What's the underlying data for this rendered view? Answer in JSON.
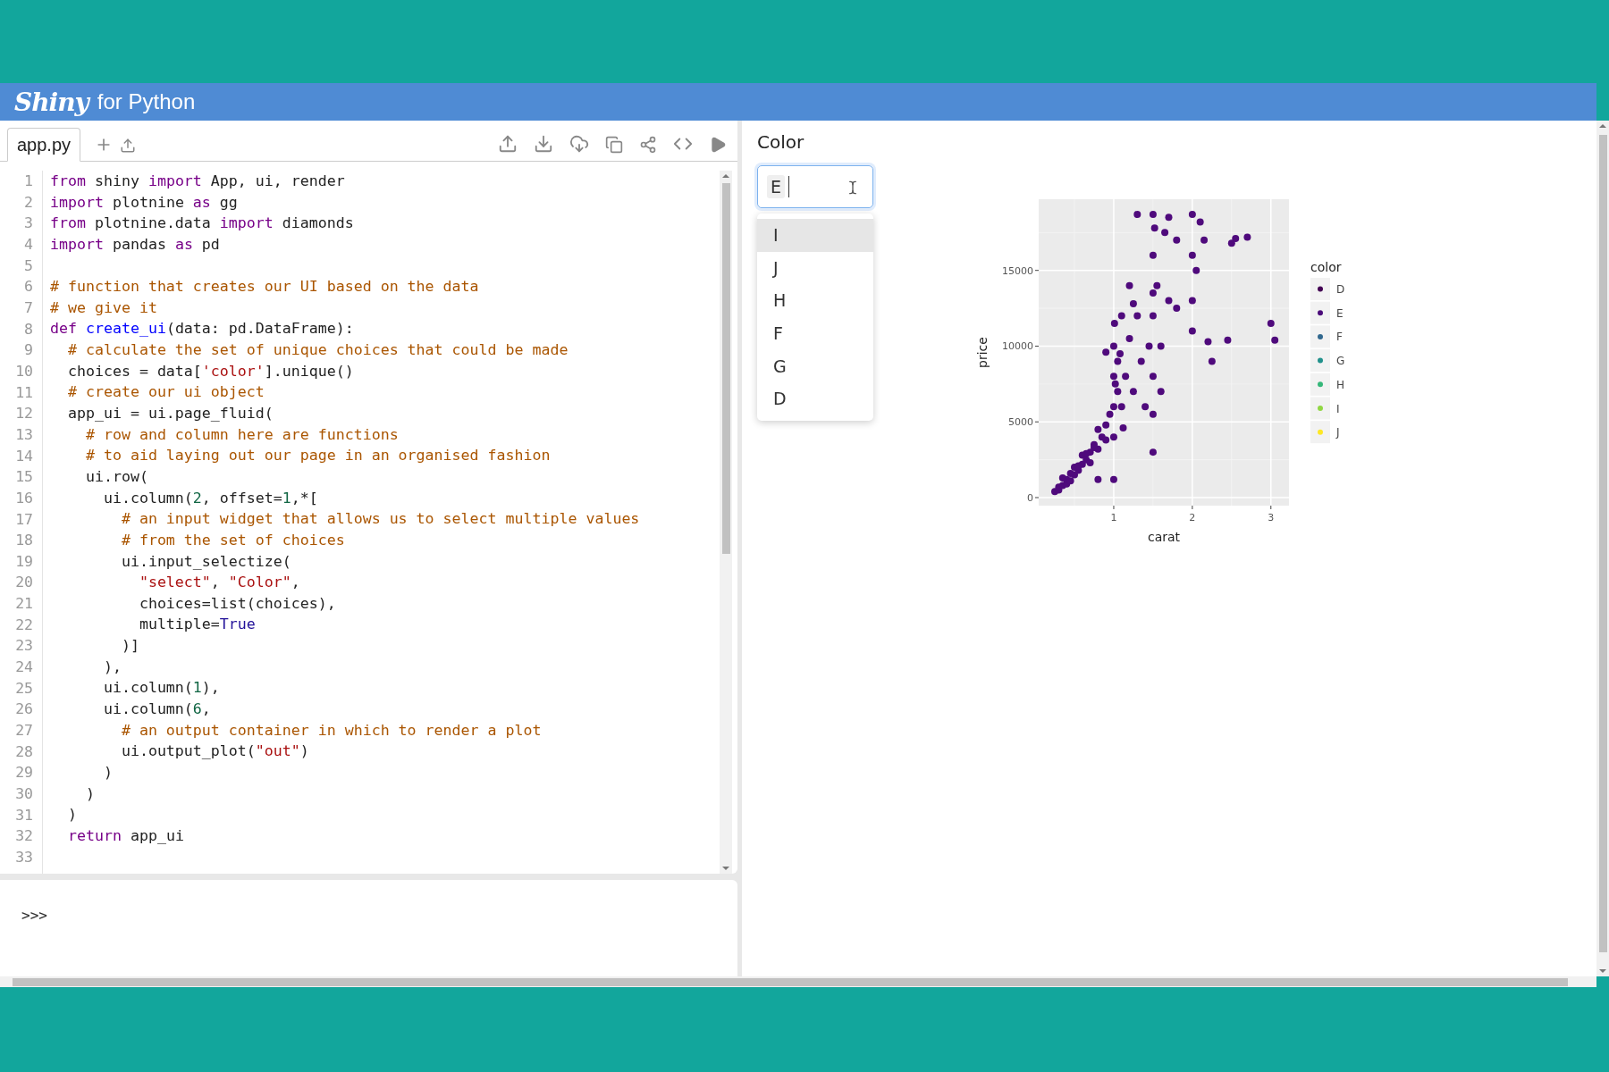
{
  "header": {
    "logo": "Shiny",
    "subtitle": "for Python"
  },
  "editor": {
    "tabs": [
      {
        "label": "app.py",
        "selected": true
      }
    ],
    "lines": [
      {
        "number": "1",
        "tokens": [
          {
            "kind": "keyword",
            "text": "from"
          },
          {
            "kind": "plain",
            "text": " shiny "
          },
          {
            "kind": "keyword",
            "text": "import"
          },
          {
            "kind": "plain",
            "text": " App, ui, render"
          }
        ]
      },
      {
        "number": "2",
        "tokens": [
          {
            "kind": "keyword",
            "text": "import"
          },
          {
            "kind": "plain",
            "text": " plotnine "
          },
          {
            "kind": "keyword",
            "text": "as"
          },
          {
            "kind": "plain",
            "text": " gg"
          }
        ]
      },
      {
        "number": "3",
        "tokens": [
          {
            "kind": "keyword",
            "text": "from"
          },
          {
            "kind": "plain",
            "text": " plotnine.data "
          },
          {
            "kind": "keyword",
            "text": "import"
          },
          {
            "kind": "plain",
            "text": " diamonds"
          }
        ]
      },
      {
        "number": "4",
        "tokens": [
          {
            "kind": "keyword",
            "text": "import"
          },
          {
            "kind": "plain",
            "text": " pandas "
          },
          {
            "kind": "keyword",
            "text": "as"
          },
          {
            "kind": "plain",
            "text": " pd"
          }
        ]
      },
      {
        "number": "5"
      },
      {
        "number": "6",
        "tokens": [
          {
            "kind": "comment",
            "text": "# function that creates our UI based on the data"
          }
        ]
      },
      {
        "number": "7",
        "tokens": [
          {
            "kind": "comment",
            "text": "# we give it"
          }
        ]
      },
      {
        "number": "8",
        "tokens": [
          {
            "kind": "keyword",
            "text": "def "
          },
          {
            "kind": "def",
            "text": "create_ui"
          },
          {
            "kind": "plain",
            "text": "(data: pd.DataFrame):"
          }
        ]
      },
      {
        "number": "9",
        "tokens": [
          {
            "kind": "comment",
            "text": "  # calculate the set of unique choices that could be made"
          }
        ]
      },
      {
        "number": "10",
        "tokens": [
          {
            "kind": "plain",
            "text": "  choices = data["
          },
          {
            "kind": "string",
            "text": "'color'"
          },
          {
            "kind": "plain",
            "text": "].unique()"
          }
        ]
      },
      {
        "number": "11",
        "tokens": [
          {
            "kind": "comment",
            "text": "  # create our ui object"
          }
        ]
      },
      {
        "number": "12",
        "tokens": [
          {
            "kind": "plain",
            "text": "  app_ui = ui.page_fluid("
          }
        ]
      },
      {
        "number": "13",
        "tokens": [
          {
            "kind": "comment",
            "text": "    # row and column here are functions"
          }
        ]
      },
      {
        "number": "14",
        "tokens": [
          {
            "kind": "comment",
            "text": "    # to aid laying out our page in an organised fashion"
          }
        ]
      },
      {
        "number": "15",
        "tokens": [
          {
            "kind": "plain",
            "text": "    ui.row("
          }
        ]
      },
      {
        "number": "16",
        "tokens": [
          {
            "kind": "plain",
            "text": "      ui.column("
          },
          {
            "kind": "number",
            "text": "2"
          },
          {
            "kind": "plain",
            "text": ", offset="
          },
          {
            "kind": "number",
            "text": "1"
          },
          {
            "kind": "plain",
            "text": ",*["
          }
        ]
      },
      {
        "number": "17",
        "tokens": [
          {
            "kind": "comment",
            "text": "        # an input widget that allows us to select multiple values"
          }
        ]
      },
      {
        "number": "18",
        "tokens": [
          {
            "kind": "comment",
            "text": "        # from the set of choices"
          }
        ]
      },
      {
        "number": "19",
        "tokens": [
          {
            "kind": "plain",
            "text": "        ui.input_selectize("
          }
        ]
      },
      {
        "number": "20",
        "tokens": [
          {
            "kind": "string",
            "text": "          \"select\""
          },
          {
            "kind": "plain",
            "text": ", "
          },
          {
            "kind": "string",
            "text": "\"Color\""
          },
          {
            "kind": "plain",
            "text": ","
          }
        ]
      },
      {
        "number": "21",
        "tokens": [
          {
            "kind": "plain",
            "text": "          choices=list(choices),"
          }
        ]
      },
      {
        "number": "22",
        "tokens": [
          {
            "kind": "plain",
            "text": "          multiple="
          },
          {
            "kind": "atom",
            "text": "True"
          }
        ]
      },
      {
        "number": "23",
        "tokens": [
          {
            "kind": "plain",
            "text": "        )]"
          }
        ]
      },
      {
        "number": "24",
        "tokens": [
          {
            "kind": "plain",
            "text": "      ),"
          }
        ]
      },
      {
        "number": "25",
        "tokens": [
          {
            "kind": "plain",
            "text": "      ui.column("
          },
          {
            "kind": "number",
            "text": "1"
          },
          {
            "kind": "plain",
            "text": "),"
          }
        ]
      },
      {
        "number": "26",
        "tokens": [
          {
            "kind": "plain",
            "text": "      ui.column("
          },
          {
            "kind": "number",
            "text": "6"
          },
          {
            "kind": "plain",
            "text": ","
          }
        ]
      },
      {
        "number": "27",
        "tokens": [
          {
            "kind": "comment",
            "text": "        # an output container in which to render a plot"
          }
        ]
      },
      {
        "number": "28",
        "tokens": [
          {
            "kind": "plain",
            "text": "        ui.output_plot("
          },
          {
            "kind": "string",
            "text": "\"out\""
          },
          {
            "kind": "plain",
            "text": ")"
          }
        ]
      },
      {
        "number": "29",
        "tokens": [
          {
            "kind": "plain",
            "text": "      )"
          }
        ]
      },
      {
        "number": "30",
        "tokens": [
          {
            "kind": "plain",
            "text": "    )"
          }
        ]
      },
      {
        "number": "31",
        "tokens": [
          {
            "kind": "plain",
            "text": "  )"
          }
        ]
      },
      {
        "number": "32",
        "tokens": [
          {
            "kind": "keyword",
            "text": "  return"
          },
          {
            "kind": "plain",
            "text": " app_ui"
          }
        ]
      },
      {
        "number": "33"
      }
    ]
  },
  "console": {
    "prompt": ">>>"
  },
  "preview": {
    "select": {
      "label": "Color",
      "chips": [
        "E"
      ],
      "options": [
        {
          "label": "I",
          "selected": true
        },
        {
          "label": "J",
          "selected": false
        },
        {
          "label": "H",
          "selected": false
        },
        {
          "label": "F",
          "selected": false
        },
        {
          "label": "G",
          "selected": false
        },
        {
          "label": "D",
          "selected": false
        }
      ]
    },
    "plot": {
      "chart_data": {
        "type": "scatter",
        "grid": true,
        "xlabel": "carat",
        "ylabel": "price",
        "xlim": [
          0.045,
          3.23
        ],
        "ylim": [
          -530,
          19700
        ],
        "xticks": [
          1,
          2,
          3
        ],
        "yticks": [
          0,
          5000,
          10000,
          15000
        ],
        "x": [
          0.25,
          0.3,
          0.3,
          0.35,
          0.4,
          0.4,
          0.45,
          0.5,
          0.5,
          0.55,
          0.6,
          0.6,
          0.65,
          0.7,
          0.7,
          0.75,
          0.8,
          0.8,
          0.85,
          0.9,
          0.9,
          0.95,
          1.0,
          1.0,
          1.0,
          1.0,
          1.01,
          1.05,
          1.05,
          1.1,
          1.1,
          1.15,
          1.2,
          1.2,
          1.25,
          1.3,
          1.3,
          1.35,
          1.4,
          1.45,
          1.5,
          1.5,
          1.5,
          1.5,
          1.5,
          1.5,
          1.55,
          1.6,
          1.6,
          1.65,
          1.7,
          1.7,
          1.8,
          1.8,
          2.0,
          2.0,
          2.0,
          2.0,
          2.05,
          2.1,
          2.15,
          2.2,
          2.25,
          2.45,
          2.5,
          2.55,
          2.7,
          3.0,
          3.05,
          0.9,
          1.0,
          0.8,
          0.35,
          0.45,
          0.55,
          0.65,
          0.75,
          1.02,
          1.08,
          1.12,
          1.5,
          1.52,
          1.25
        ],
        "series": [
          {
            "color": "#4f0a7c",
            "values": [
              400,
              500,
              700,
              800,
              900,
              1200,
              1100,
              1500,
              2000,
              1800,
              2200,
              2800,
              2500,
              3000,
              2300,
              3500,
              3200,
              4500,
              4000,
              4800,
              3800,
              5500,
              4000,
              6000,
              8000,
              10000,
              11500,
              9000,
              7000,
              6000,
              12000,
              8000,
              14000,
              10500,
              7000,
              18700,
              12000,
              9000,
              6000,
              10000,
              18700,
              16000,
              12000,
              8000,
              5500,
              3000,
              14000,
              10000,
              7000,
              17500,
              13000,
              18500,
              17000,
              12500,
              18700,
              16000,
              13000,
              11000,
              15000,
              18200,
              17000,
              10300,
              9000,
              10400,
              16800,
              17100,
              17200,
              11500,
              10400,
              9600,
              1200,
              1200,
              1300,
              1600,
              2100,
              2900,
              3300,
              7500,
              9500,
              4600,
              13500,
              17800,
              12800
            ]
          }
        ]
      },
      "legend": {
        "title": "color",
        "items": [
          {
            "label": "D",
            "color": "#440154"
          },
          {
            "label": "E",
            "color": "#4b0c7a"
          },
          {
            "label": "F",
            "color": "#31688e"
          },
          {
            "label": "G",
            "color": "#21918c"
          },
          {
            "label": "H",
            "color": "#35b779"
          },
          {
            "label": "I",
            "color": "#90d743"
          },
          {
            "label": "J",
            "color": "#fde725"
          }
        ]
      }
    }
  }
}
